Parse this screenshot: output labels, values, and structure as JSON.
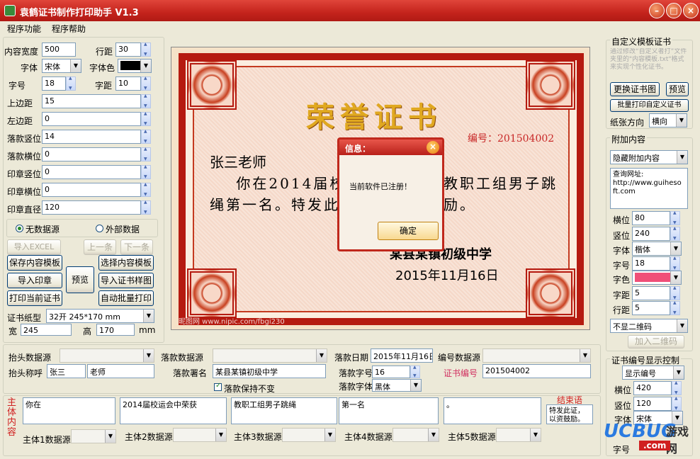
{
  "window": {
    "title": "袁鹤证书制作打印助手  V1.3",
    "min_icon": "minimize-icon",
    "max_icon": "maximize-icon",
    "close_icon": "close-icon"
  },
  "menu": {
    "items": [
      "程序功能",
      "程序帮助"
    ]
  },
  "left": {
    "content_width_label": "内容宽度",
    "content_width": "500",
    "line_spacing_label": "行距",
    "line_spacing": "30",
    "font_label": "字体",
    "font": "宋体",
    "font_color_label": "字体色",
    "font_color": "#000000",
    "font_size_label": "字号",
    "font_size": "18",
    "char_spacing_label": "字距",
    "char_spacing": "10",
    "top_margin_label": "上边距",
    "top_margin": "15",
    "left_margin_label": "左边距",
    "left_margin": "0",
    "sign_v_label": "落款竖位",
    "sign_v": "14",
    "sign_h_label": "落款横位",
    "sign_h": "0",
    "stamp_v_label": "印章竖位",
    "stamp_v": "0",
    "stamp_h_label": "印章横位",
    "stamp_h": "0",
    "stamp_d_label": "印章直径",
    "stamp_d": "120",
    "radio_no_source": "无数据源",
    "radio_external": "外部数据",
    "btn_import_excel": "导入EXCEL",
    "btn_prev": "上一条",
    "btn_next": "下一条",
    "btn_save_template": "保存内容模板",
    "btn_select_template": "选择内容模板",
    "btn_import_stamp": "导入印章",
    "btn_preview": "预览",
    "btn_import_sample": "导入证书样图",
    "btn_print_current": "打印当前证书",
    "btn_auto_batch": "自动批量打印",
    "paper_type_label": "证书纸型",
    "paper_type": "32开 245*170 mm",
    "width_label": "宽",
    "width": "245",
    "height_label": "高",
    "height": "170",
    "unit": "mm"
  },
  "certificate": {
    "title": "荣誉证书",
    "number_text": "编号：201504002",
    "recipient": "张三老师",
    "body_line1": "    你在2014届校",
    "body_line1b": "教职工组男子跳",
    "body_line2": "绳第一名。特发此",
    "body_line2b": "励。",
    "org": "某县某镇初级中学",
    "date": "2015年11月16日",
    "watermark": "昵图网 www.nipic.com/fbgi230"
  },
  "dialog": {
    "title": "信息：",
    "message": "当前软件已注册！",
    "ok": "确定"
  },
  "right": {
    "custom_group": "自定义模板证书",
    "custom_desc": "通过修改“自定义者打”文件夹里的\"内容模板.txt\"格式来实现个性化证书。",
    "btn_change": "更换证书图",
    "btn_preview": "预览",
    "btn_batch_custom": "批量打印自定义证书",
    "orient_label": "纸张方向",
    "orient": "横向",
    "extra_group": "附加内容",
    "extra_mode": "隐藏附加内容",
    "extra_text": "查询网址:\nhttp://www.guiheso\nft.com",
    "x_label": "横位",
    "x": "80",
    "y_label": "竖位",
    "y": "240",
    "font_label": "字体",
    "font": "楷体",
    "size_label": "字号",
    "size": "18",
    "color_label": "字色",
    "color": "#f05078",
    "cs_label": "字距",
    "cs": "5",
    "ls_label": "行距",
    "ls": "5",
    "qr_mode": "不显二维码",
    "btn_add_qr": "加入二维码",
    "num_group": "证书编号显示控制",
    "num_mode": "显示编号",
    "nx_label": "横位",
    "nx": "420",
    "ny_label": "竖位",
    "ny": "120",
    "nfont_label": "字体",
    "nfont": "宋体",
    "nsize_label": "字号"
  },
  "bottom": {
    "head_src_label": "抬头数据源",
    "sign_src_label": "落款数据源",
    "sign_date_label": "落款日期",
    "sign_date": "2015年11月16日",
    "num_src_label": "编号数据源",
    "head_name_label": "抬头称呼",
    "head_name": "张三",
    "head_title": "老师",
    "sign_name_label": "落款署名",
    "sign_name": "某县某镇初级中学",
    "sign_size_label": "落款字号",
    "sign_size": "16",
    "cert_num_label": "证书编号",
    "cert_num": "201504002",
    "keep_sign": "落款保持不变",
    "sign_font_label": "落款字体",
    "sign_font": "黑体",
    "main_label": "主体内容",
    "main": [
      "你在",
      "2014届校运会中荣获",
      "教职工组男子跳绳",
      "第一名",
      "。"
    ],
    "main_src": [
      "主体1数据源",
      "主体2数据源",
      "主体3数据源",
      "主体4数据源",
      "主体5数据源"
    ],
    "end_label": "结束语",
    "end_text": "特发此证，以资鼓励。"
  },
  "logo": {
    "text1": "UCBUG",
    "text2": "游戏网",
    "text3": ".com"
  }
}
